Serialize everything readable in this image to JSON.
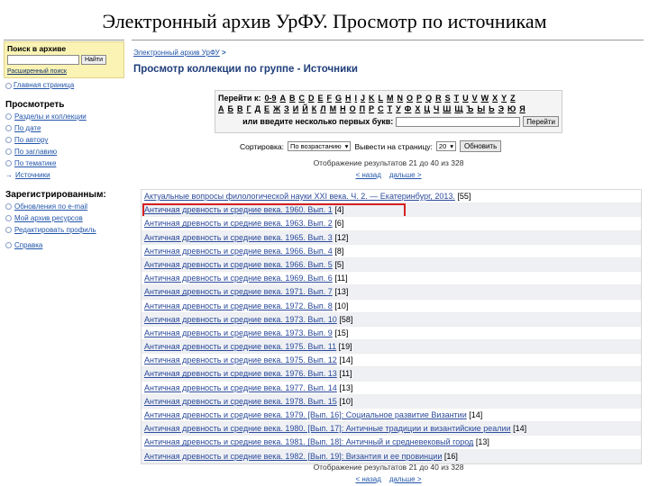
{
  "slide_title": "Электронный архив УрФУ. Просмотр по источникам",
  "sidebar": {
    "search_label": "Поиск в архиве",
    "search_button": "Найти",
    "advanced_search": "Расширенный поиск",
    "home_link": "Главная страница",
    "browse_heading": "Просмотреть",
    "browse_items": [
      {
        "label": "Разделы и коллекции",
        "icon": "bullet"
      },
      {
        "label": "По дате",
        "icon": "bullet"
      },
      {
        "label": "По автору",
        "icon": "bullet"
      },
      {
        "label": "По заглавию",
        "icon": "bullet"
      },
      {
        "label": "По тематике",
        "icon": "bullet"
      },
      {
        "label": "Источники",
        "icon": "arrow"
      }
    ],
    "registered_heading": "Зарегистрированным:",
    "registered_items": [
      {
        "label": "Обновления по e-mail"
      },
      {
        "label": "Мой архив ресурсов"
      },
      {
        "label": "Редактировать профиль"
      }
    ],
    "help_link": "Справка"
  },
  "main": {
    "breadcrumb": "Электронный архив УрФУ",
    "breadcrumb_sep": ">",
    "heading": "Просмотр коллекции по группе - Источники",
    "jump_label": "Перейти к:",
    "latin_letters": [
      "0-9",
      "A",
      "B",
      "C",
      "D",
      "E",
      "F",
      "G",
      "H",
      "I",
      "J",
      "K",
      "L",
      "M",
      "N",
      "O",
      "P",
      "Q",
      "R",
      "S",
      "T",
      "U",
      "V",
      "W",
      "X",
      "Y",
      "Z"
    ],
    "cyrillic_letters": [
      "А",
      "Б",
      "В",
      "Г",
      "Д",
      "Е",
      "Ж",
      "З",
      "И",
      "Й",
      "К",
      "Л",
      "М",
      "Н",
      "О",
      "П",
      "Р",
      "С",
      "Т",
      "У",
      "Ф",
      "Х",
      "Ц",
      "Ч",
      "Ш",
      "Щ",
      "Ъ",
      "Ы",
      "Ь",
      "Э",
      "Ю",
      "Я"
    ],
    "prefix_label": "или введите несколько первых букв:",
    "go_button": "Перейти",
    "sort_label": "Сортировка:",
    "sort_value": "По возрастанию",
    "per_page_label": "Вывести на страницу:",
    "per_page_value": "20",
    "update_button": "Обновить",
    "showing": "Отображение результатов 21 до 40 из 328",
    "prev": "< назад",
    "next": "дальше >",
    "results": [
      {
        "title": "Актуальные вопросы филологической науки XXI века. Ч. 2. — Екатеринбург, 2013.",
        "count": "[55]"
      },
      {
        "title": "Античная древность и средние века. 1960. Вып. 1",
        "count": "[4]",
        "highlight": true
      },
      {
        "title": "Античная древность и средние века. 1963. Вып. 2",
        "count": "[6]"
      },
      {
        "title": "Античная древность и средние века. 1965. Вып. 3",
        "count": "[12]"
      },
      {
        "title": "Античная древность и средние века. 1966. Вып. 4",
        "count": "[8]"
      },
      {
        "title": "Античная древность и средние века. 1966. Вып. 5",
        "count": "[5]"
      },
      {
        "title": "Античная древность и средние века. 1969. Вып. 6",
        "count": "[11]"
      },
      {
        "title": "Античная древность и средние века. 1971. Вып. 7",
        "count": "[13]"
      },
      {
        "title": "Античная древность и средние века. 1972. Вып. 8",
        "count": "[10]"
      },
      {
        "title": "Античная древность и средние века. 1973. Вып. 10",
        "count": "[58]"
      },
      {
        "title": "Античная древность и средние века. 1973. Вып. 9",
        "count": "[15]"
      },
      {
        "title": "Античная древность и средние века. 1975. Вып. 11",
        "count": "[19]"
      },
      {
        "title": "Античная древность и средние века. 1975. Вып. 12",
        "count": "[14]"
      },
      {
        "title": "Античная древность и средние века. 1976. Вып. 13",
        "count": "[11]"
      },
      {
        "title": "Античная древность и средние века. 1977. Вып. 14",
        "count": "[13]"
      },
      {
        "title": "Античная древность и средние века. 1978. Вып. 15",
        "count": "[10]"
      },
      {
        "title": "Античная древность и средние века. 1979. [Вып. 16]: Социальное развитие Византии",
        "count": "[14]"
      },
      {
        "title": "Античная древность и средние века. 1980. [Вып. 17]: Античные традиции и византийские реалии",
        "count": "[14]"
      },
      {
        "title": "Античная древность и средние века. 1981. [Вып. 18]: Античный и средневековый город",
        "count": "[13]"
      },
      {
        "title": "Античная древность и средние века. 1982. [Вып. 19]: Византия и ее провинции",
        "count": "[16]"
      }
    ]
  }
}
